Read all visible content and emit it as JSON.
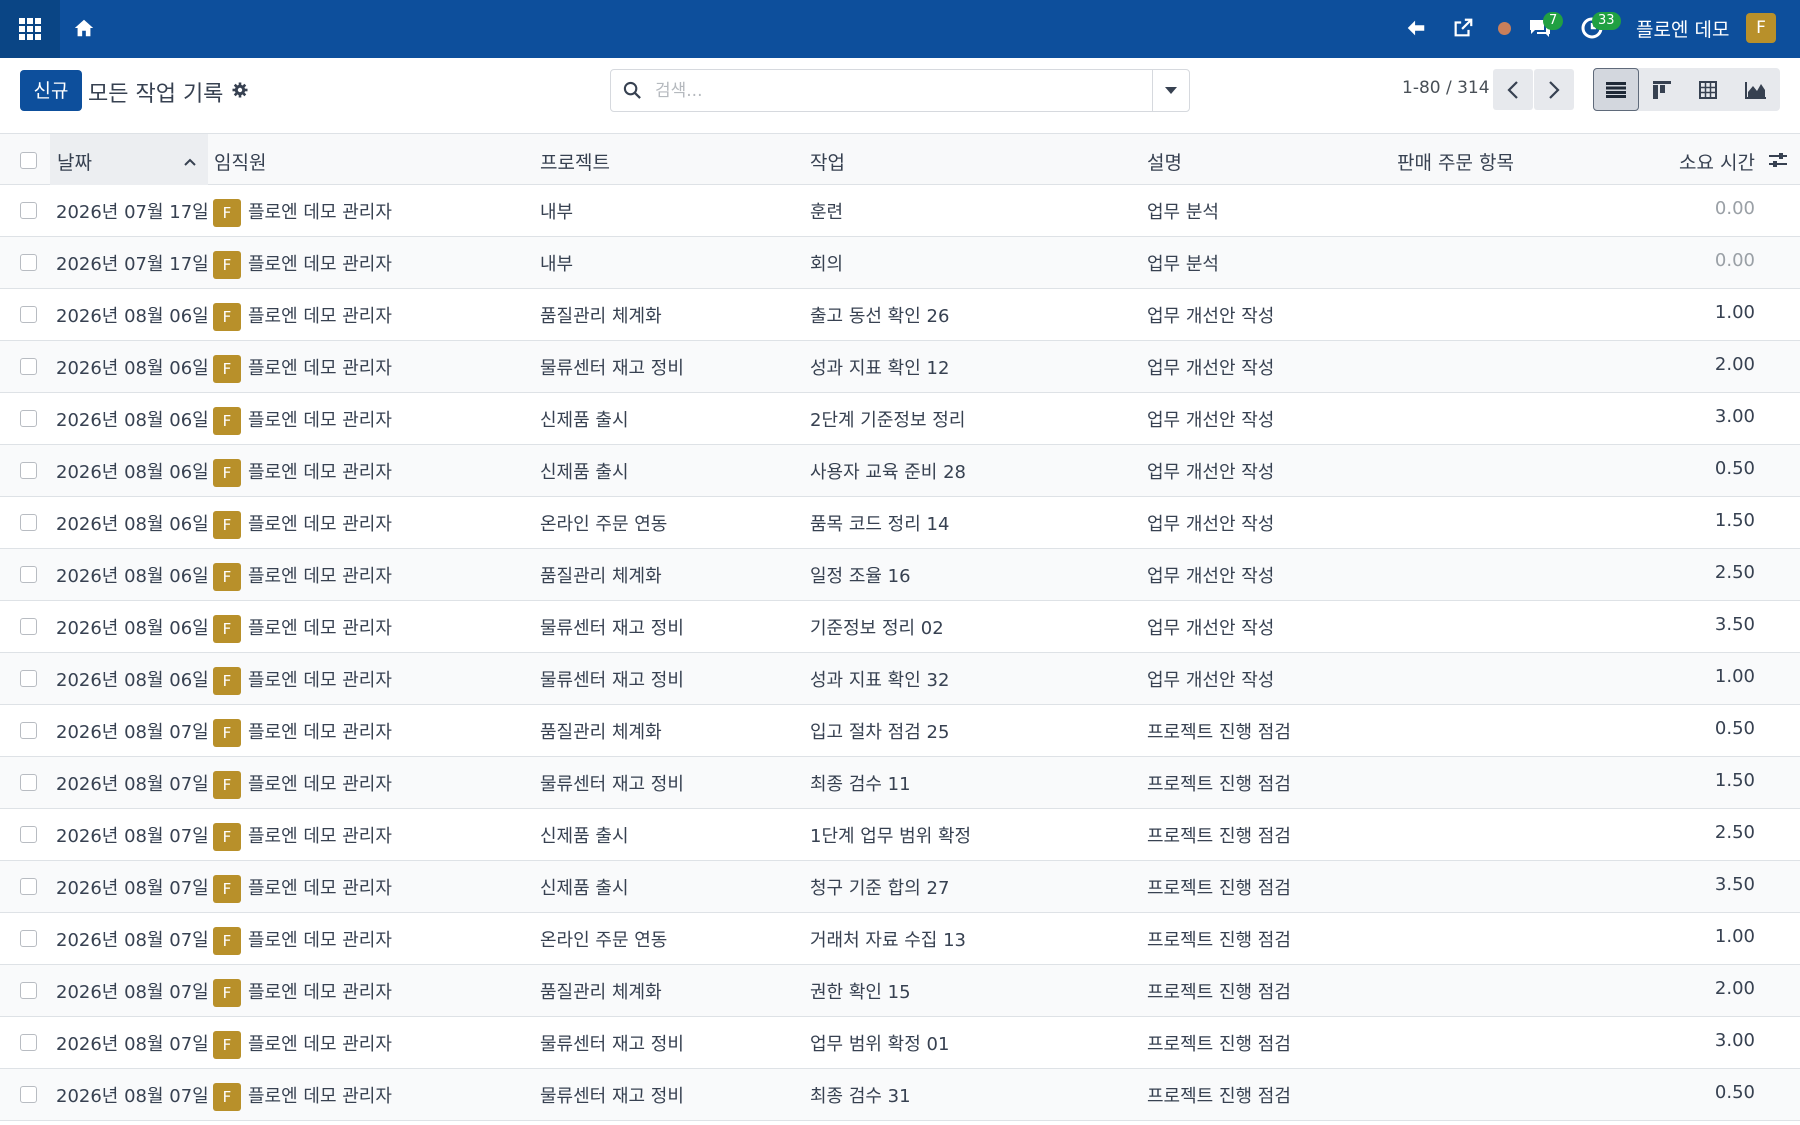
{
  "navbar": {
    "user_name": "플로엔 데모",
    "avatar_letter": "F",
    "messages_count": "7",
    "activities_count": "33",
    "status_color": "#c97f5a"
  },
  "control_panel": {
    "new_button": "신규",
    "title": "모든 작업 기록",
    "search_placeholder": "검색...",
    "pager": "1-80 / 314"
  },
  "table": {
    "headers": {
      "date": "날짜",
      "employee": "임직원",
      "project": "프로젝트",
      "task": "작업",
      "description": "설명",
      "sale_order_item": "판매 주문 항목",
      "hours": "소요 시간"
    },
    "rows": [
      {
        "date": "2026년 07월 17일",
        "avatar": "F",
        "employee": "플로엔 데모 관리자",
        "project": "내부",
        "task": "훈련",
        "description": "업무 분석",
        "hours": "0.00"
      },
      {
        "date": "2026년 07월 17일",
        "avatar": "F",
        "employee": "플로엔 데모 관리자",
        "project": "내부",
        "task": "회의",
        "description": "업무 분석",
        "hours": "0.00"
      },
      {
        "date": "2026년 08월 06일",
        "avatar": "F",
        "employee": "플로엔 데모 관리자",
        "project": "품질관리 체계화",
        "task": "출고 동선 확인 26",
        "description": "업무 개선안 작성",
        "hours": "1.00"
      },
      {
        "date": "2026년 08월 06일",
        "avatar": "F",
        "employee": "플로엔 데모 관리자",
        "project": "물류센터 재고 정비",
        "task": "성과 지표 확인 12",
        "description": "업무 개선안 작성",
        "hours": "2.00"
      },
      {
        "date": "2026년 08월 06일",
        "avatar": "F",
        "employee": "플로엔 데모 관리자",
        "project": "신제품 출시",
        "task": "2단계 기준정보 정리",
        "description": "업무 개선안 작성",
        "hours": "3.00"
      },
      {
        "date": "2026년 08월 06일",
        "avatar": "F",
        "employee": "플로엔 데모 관리자",
        "project": "신제품 출시",
        "task": "사용자 교육 준비 28",
        "description": "업무 개선안 작성",
        "hours": "0.50"
      },
      {
        "date": "2026년 08월 06일",
        "avatar": "F",
        "employee": "플로엔 데모 관리자",
        "project": "온라인 주문 연동",
        "task": "품목 코드 정리 14",
        "description": "업무 개선안 작성",
        "hours": "1.50"
      },
      {
        "date": "2026년 08월 06일",
        "avatar": "F",
        "employee": "플로엔 데모 관리자",
        "project": "품질관리 체계화",
        "task": "일정 조율 16",
        "description": "업무 개선안 작성",
        "hours": "2.50"
      },
      {
        "date": "2026년 08월 06일",
        "avatar": "F",
        "employee": "플로엔 데모 관리자",
        "project": "물류센터 재고 정비",
        "task": "기준정보 정리 02",
        "description": "업무 개선안 작성",
        "hours": "3.50"
      },
      {
        "date": "2026년 08월 06일",
        "avatar": "F",
        "employee": "플로엔 데모 관리자",
        "project": "물류센터 재고 정비",
        "task": "성과 지표 확인 32",
        "description": "업무 개선안 작성",
        "hours": "1.00"
      },
      {
        "date": "2026년 08월 07일",
        "avatar": "F",
        "employee": "플로엔 데모 관리자",
        "project": "품질관리 체계화",
        "task": "입고 절차 점검 25",
        "description": "프로젝트 진행 점검",
        "hours": "0.50"
      },
      {
        "date": "2026년 08월 07일",
        "avatar": "F",
        "employee": "플로엔 데모 관리자",
        "project": "물류센터 재고 정비",
        "task": "최종 검수 11",
        "description": "프로젝트 진행 점검",
        "hours": "1.50"
      },
      {
        "date": "2026년 08월 07일",
        "avatar": "F",
        "employee": "플로엔 데모 관리자",
        "project": "신제품 출시",
        "task": "1단계 업무 범위 확정",
        "description": "프로젝트 진행 점검",
        "hours": "2.50"
      },
      {
        "date": "2026년 08월 07일",
        "avatar": "F",
        "employee": "플로엔 데모 관리자",
        "project": "신제품 출시",
        "task": "청구 기준 합의 27",
        "description": "프로젝트 진행 점검",
        "hours": "3.50"
      },
      {
        "date": "2026년 08월 07일",
        "avatar": "F",
        "employee": "플로엔 데모 관리자",
        "project": "온라인 주문 연동",
        "task": "거래처 자료 수집 13",
        "description": "프로젝트 진행 점검",
        "hours": "1.00"
      },
      {
        "date": "2026년 08월 07일",
        "avatar": "F",
        "employee": "플로엔 데모 관리자",
        "project": "품질관리 체계화",
        "task": "권한 확인 15",
        "description": "프로젝트 진행 점검",
        "hours": "2.00"
      },
      {
        "date": "2026년 08월 07일",
        "avatar": "F",
        "employee": "플로엔 데모 관리자",
        "project": "물류센터 재고 정비",
        "task": "업무 범위 확정 01",
        "description": "프로젝트 진행 점검",
        "hours": "3.00"
      },
      {
        "date": "2026년 08월 07일",
        "avatar": "F",
        "employee": "플로엔 데모 관리자",
        "project": "물류센터 재고 정비",
        "task": "최종 검수 31",
        "description": "프로젝트 진행 점검",
        "hours": "0.50"
      }
    ]
  },
  "icons": {
    "apps": "apps-grid-icon",
    "home": "home-icon",
    "back": "back-arrow-icon",
    "external": "external-link-icon",
    "status": "status-dot-icon",
    "messages": "chat-icon",
    "activities": "clock-icon",
    "gear": "gear-icon",
    "search": "search-icon",
    "sort": "sort-asc-icon",
    "optional_columns": "column-settings-icon"
  }
}
